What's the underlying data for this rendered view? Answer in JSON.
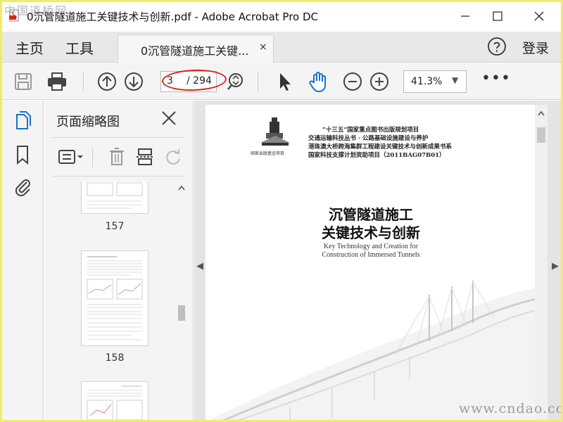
{
  "window": {
    "title": "0沉管隧道施工关键技术与创新.pdf - Adobe Acrobat Pro DC",
    "watermark_top": "中国道桥网",
    "watermark_bottom": "www.cndao.com"
  },
  "menubar": {
    "home": "主页",
    "tools": "工具",
    "tab_label": "0沉管隧道施工关键...",
    "tab_close": "×",
    "login": "登录"
  },
  "toolbar": {
    "current_page": "3",
    "total_pages": "/ 294",
    "zoom": "41.3%",
    "more": "•••",
    "icons": [
      "save-icon",
      "print-icon",
      "prev-page-icon",
      "next-page-icon",
      "page-search-icon",
      "select-arrow-icon",
      "hand-icon",
      "zoom-out-icon",
      "zoom-in-icon"
    ]
  },
  "rail": {
    "icons": [
      "page-thumbnails-icon",
      "bookmark-icon",
      "attachment-icon"
    ]
  },
  "panel": {
    "title": "页面缩略图",
    "thumbnails": [
      {
        "label": "157"
      },
      {
        "label": "158"
      },
      {
        "label": ""
      }
    ]
  },
  "document": {
    "header_lines": [
      "“十三五”国家重点图书出版规划项目",
      "交通运输科技丛书 · 公路基础设施建设与养护",
      "港珠澳大桥跨海集群工程建设关键技术与创新成果书系",
      "国家科技支撑计划资助项目（2011BAG07B01）"
    ],
    "publisher_line": "国家出版基金项目",
    "title_line1": "沉管隧道施工",
    "title_line2": "关键技术与创新",
    "english_line1": "Key Technology and Creation for",
    "english_line2": "Construction of Immersed Tunnels"
  },
  "colors": {
    "accent": "#1a6fd1",
    "annotation": "#d9261c",
    "frame": "#f2ea6a"
  }
}
